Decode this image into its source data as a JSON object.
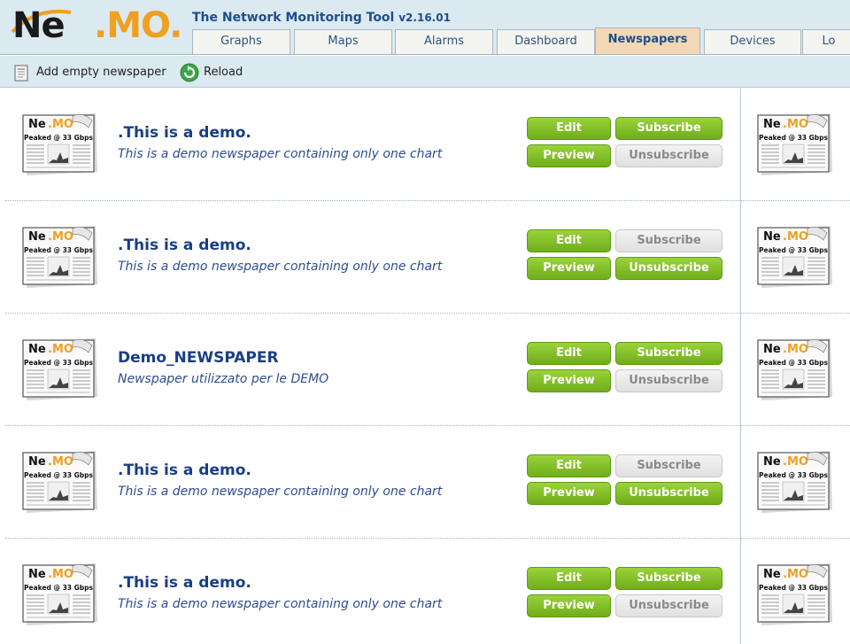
{
  "app": {
    "logo_text_ne": "Ne",
    "logo_text_mo": ".MO.",
    "title": "The Network Monitoring Tool",
    "version": "v2.16.01"
  },
  "tabs": [
    {
      "label": "Graphs",
      "active": false
    },
    {
      "label": "Maps",
      "active": false
    },
    {
      "label": "Alarms",
      "active": false
    },
    {
      "label": "Dashboard",
      "active": false
    },
    {
      "label": "Newspapers",
      "active": true
    },
    {
      "label": "Devices",
      "active": false
    },
    {
      "label": "Lo",
      "active": false
    }
  ],
  "toolbar": {
    "add_label": "Add empty newspaper",
    "reload_label": "Reload"
  },
  "thumbnail": {
    "brand_ne": "Ne",
    "brand_mo": ".MO",
    "caption": "Peaked @ 33 Gbps"
  },
  "buttons": {
    "edit": "Edit",
    "preview": "Preview",
    "subscribe": "Subscribe",
    "unsubscribe": "Unsubscribe"
  },
  "newspapers": [
    {
      "title": ".This is a demo.",
      "description": "This is a demo newspaper containing only one chart",
      "subscribed": false
    },
    {
      "title": ".This is a demo.",
      "description": "This is a demo newspaper containing only one chart",
      "subscribed": true
    },
    {
      "title": "Demo_NEWSPAPER",
      "description": "Newspaper utilizzato per le DEMO",
      "subscribed": false
    },
    {
      "title": ".This is a demo.",
      "description": "This is a demo newspaper containing only one chart",
      "subscribed": true
    },
    {
      "title": ".This is a demo.",
      "description": "This is a demo newspaper containing only one chart",
      "subscribed": false
    }
  ],
  "colors": {
    "accent_green": "#7dbd22",
    "header_bg": "#dbe9f0",
    "title_blue": "#1a3e86",
    "active_tab": "#f2d8b4"
  }
}
